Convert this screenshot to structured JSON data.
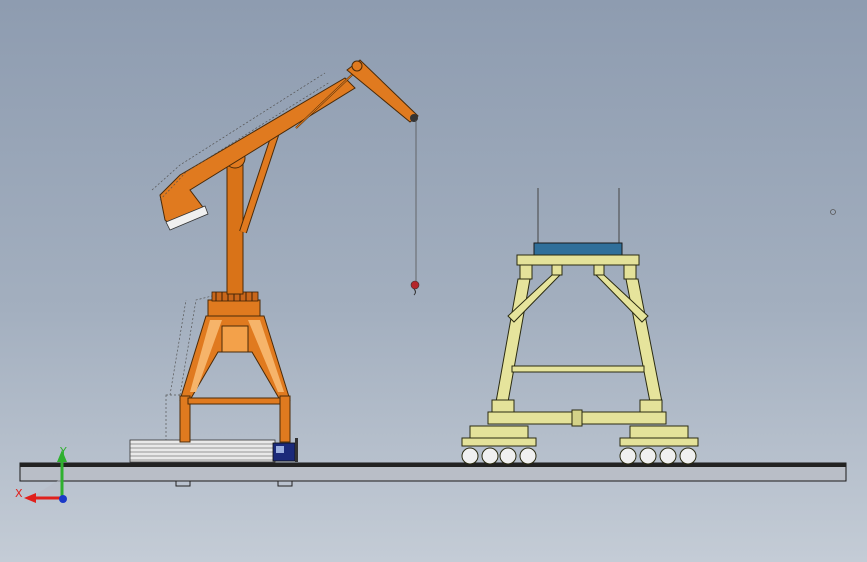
{
  "view": {
    "background_top": "#8e9cb0",
    "background_bottom": "#c4ccd6"
  },
  "triad": {
    "x_label": "X",
    "y_label": "Y",
    "x_color": "#e0201c",
    "y_color": "#2fb02f",
    "z_color": "#1a39c8"
  },
  "models": {
    "portal_crane": {
      "color": "#e07a1f",
      "icon": "portal-crane"
    },
    "gantry_frame": {
      "color": "#e4e29a",
      "icon": "gantry-frame",
      "top_beam_color": "#2f6f9a"
    },
    "ground_rail": {
      "color": "#b8bdc6"
    }
  }
}
